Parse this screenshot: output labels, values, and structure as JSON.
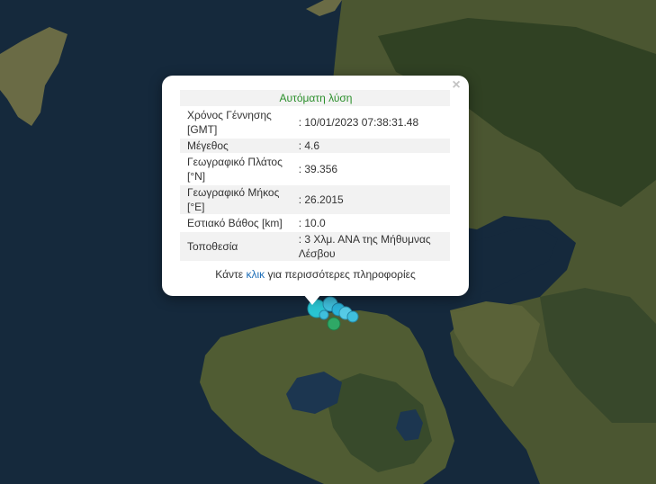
{
  "popup": {
    "title": "Αυτόματη λύση",
    "close_symbol": "×",
    "rows": [
      {
        "label": "Χρόνος Γέννησης [GMT]",
        "value": ": 10/01/2023 07:38:31.48"
      },
      {
        "label": "Μέγεθος",
        "value": ": 4.6"
      },
      {
        "label": "Γεωγραφικό Πλάτος [°N]",
        "value": ": 39.356"
      },
      {
        "label": "Γεωγραφικό Μήκος [°E]",
        "value": ": 26.2015"
      },
      {
        "label": "Εστιακό Βάθος [km]",
        "value": ": 10.0"
      },
      {
        "label": "Τοποθεσία",
        "value": ": 3 Χλμ. ΑΝΑ της Μήθυμνας Λέσβου"
      }
    ],
    "more_prefix": "Κάντε ",
    "more_link": "κλικ",
    "more_suffix": " για περισσότερες πληροφορίες"
  },
  "map": {
    "colors": {
      "sea": "#15293c",
      "land": "#4e5a33",
      "mountain": "#2f4022",
      "lake": "#1c3650"
    },
    "markers": [
      {
        "icon": "earthquake-marker-icon",
        "color": "#29c4d2",
        "magnitude": "4.6",
        "selected": true
      },
      {
        "icon": "earthquake-marker-icon",
        "color": "#3fbfdc"
      },
      {
        "icon": "earthquake-marker-icon",
        "color": "#2ab3d9"
      },
      {
        "icon": "earthquake-marker-icon",
        "color": "#56cbe6"
      },
      {
        "icon": "earthquake-marker-icon",
        "color": "#3fbfdc"
      },
      {
        "icon": "earthquake-marker-icon",
        "color": "#2fa866"
      },
      {
        "icon": "earthquake-marker-icon",
        "color": "#3fbfdc"
      }
    ]
  }
}
